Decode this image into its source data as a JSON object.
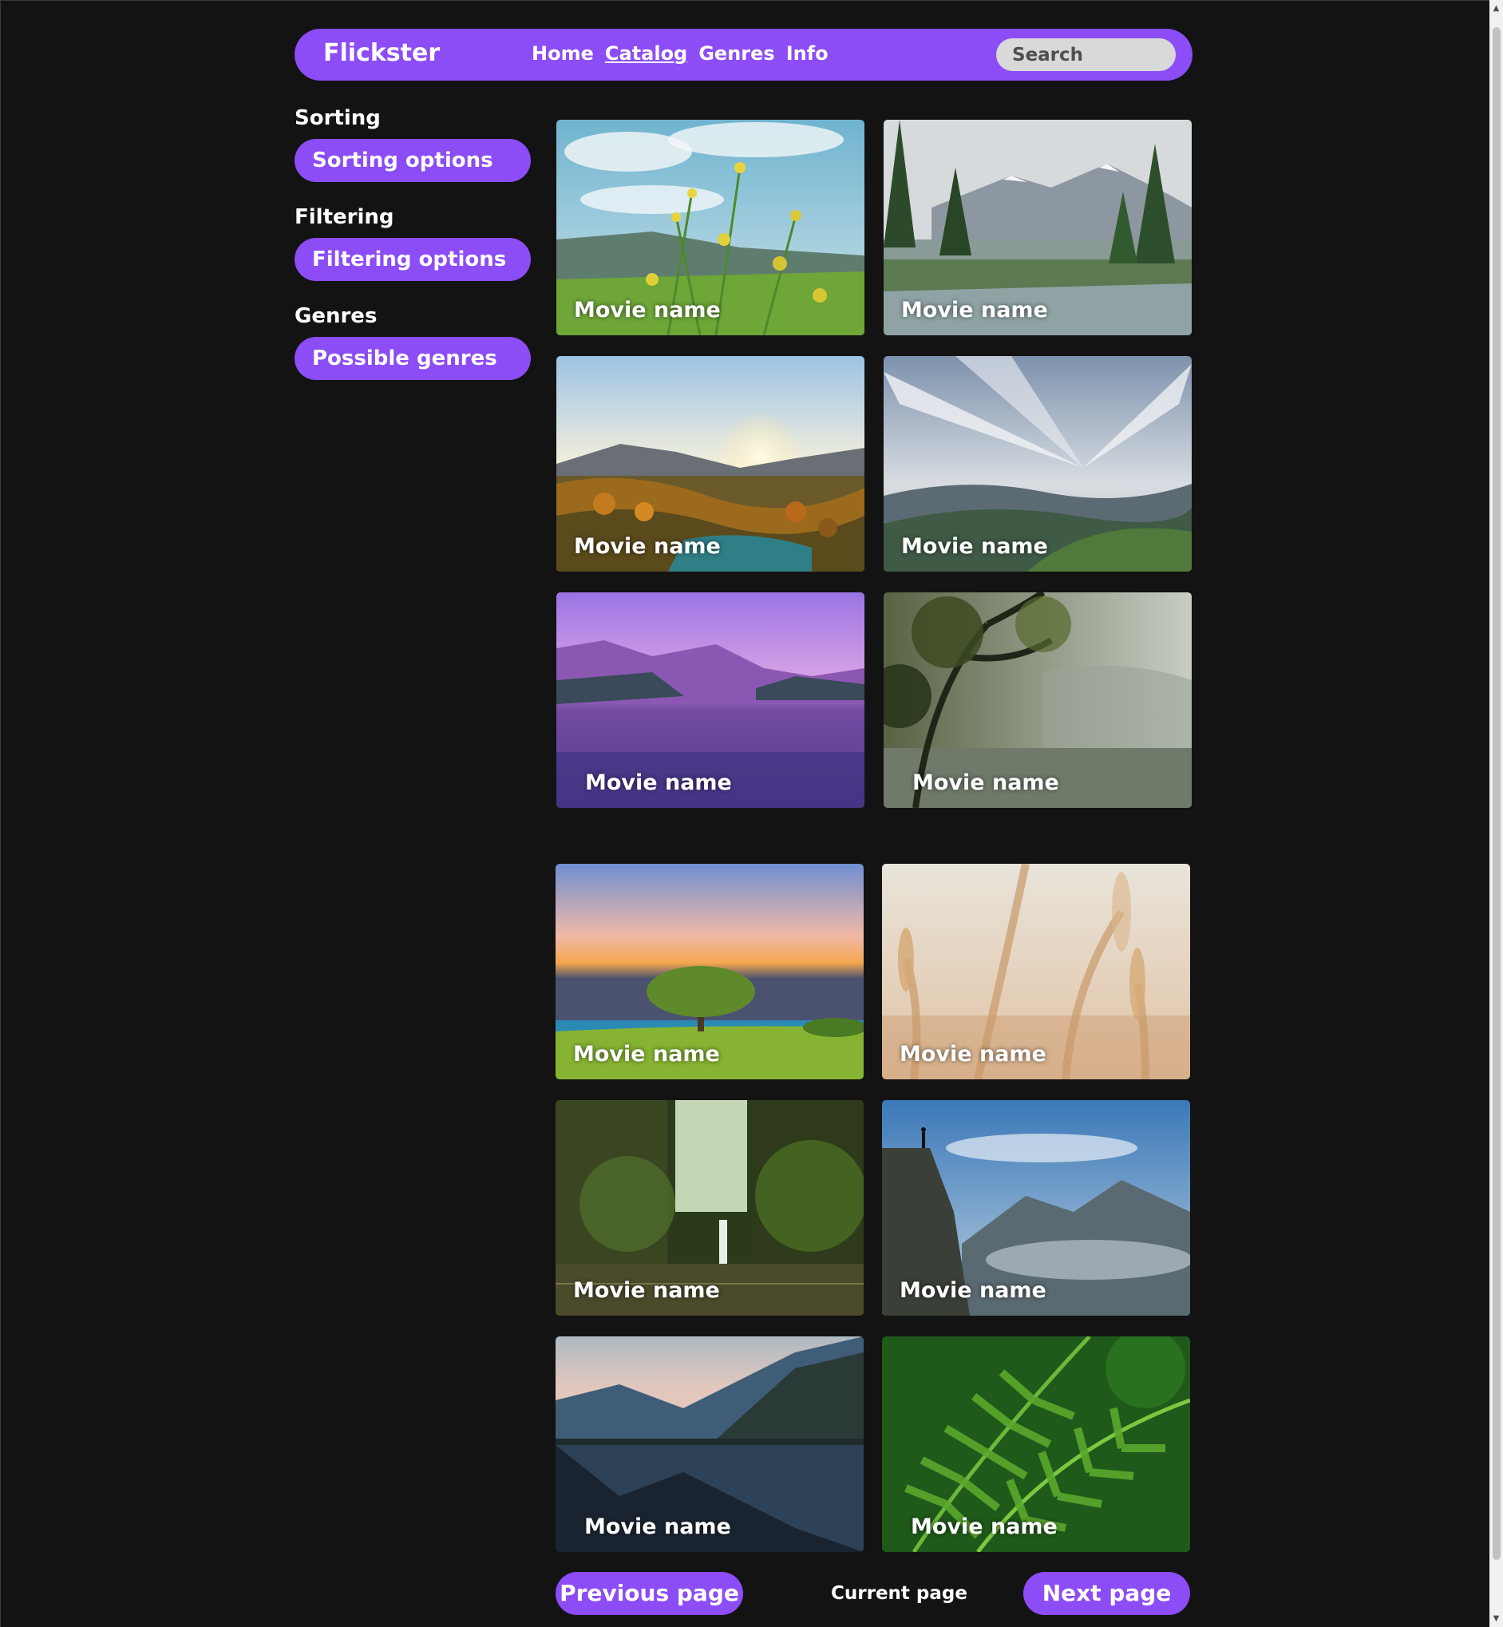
{
  "header": {
    "brand": "Flickster",
    "nav": [
      {
        "label": "Home",
        "active": false
      },
      {
        "label": "Catalog",
        "active": true
      },
      {
        "label": "Genres",
        "active": false
      },
      {
        "label": "Info",
        "active": false
      }
    ],
    "search_placeholder": "Search"
  },
  "sidebar": {
    "groups": [
      {
        "heading": "Sorting",
        "button": "Sorting options"
      },
      {
        "heading": "Filtering",
        "button": "Filtering options"
      },
      {
        "heading": "Genres",
        "button": "Possible genres"
      }
    ]
  },
  "movies": [
    {
      "title": "Movie name",
      "scene": "yellow-flowers-meadow"
    },
    {
      "title": "Movie name",
      "scene": "mountain-lake-pines"
    },
    {
      "title": "Movie name",
      "scene": "sunset-valley"
    },
    {
      "title": "Movie name",
      "scene": "clouds-over-hills"
    },
    {
      "title": "Movie name",
      "scene": "purple-lake"
    },
    {
      "title": "Movie name",
      "scene": "misty-tree"
    },
    {
      "title": "Movie name",
      "scene": "tree-at-sunset"
    },
    {
      "title": "Movie name",
      "scene": "wheat-closeup"
    },
    {
      "title": "Movie name",
      "scene": "forest-waterfall"
    },
    {
      "title": "Movie name",
      "scene": "cliff-over-clouds"
    },
    {
      "title": "Movie name",
      "scene": "mountain-lake-reflection"
    },
    {
      "title": "Movie name",
      "scene": "fern-leaves"
    }
  ],
  "pagination": {
    "previous": "Previous page",
    "current": "Current page",
    "next": "Next page"
  },
  "colors": {
    "accent": "#8c4cf6",
    "background": "#131313",
    "search_bg": "#d9d9d9"
  }
}
